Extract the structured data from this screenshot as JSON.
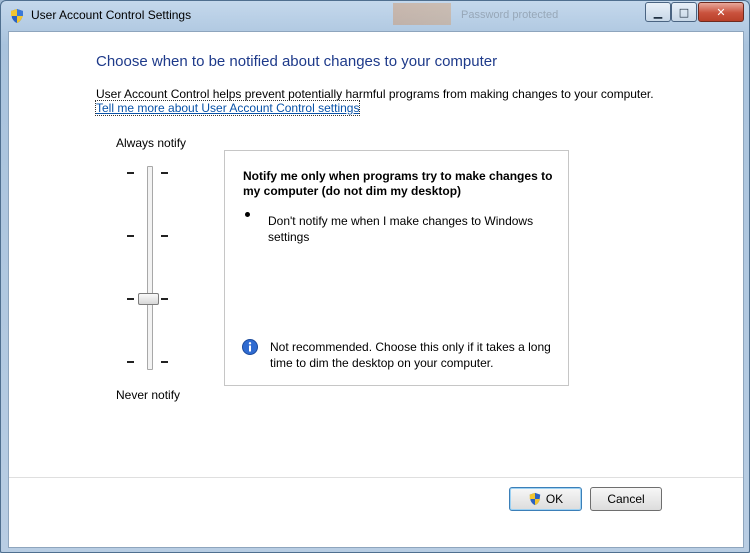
{
  "window": {
    "title": "User Account Control Settings",
    "background_tab_text": "Password protected"
  },
  "content": {
    "heading": "Choose when to be notified about changes to your computer",
    "description": "User Account Control helps prevent potentially harmful programs from making changes to your computer.",
    "link": "Tell me more about User Account Control settings"
  },
  "slider": {
    "top_label": "Always notify",
    "bottom_label": "Never notify",
    "levels": 4,
    "selected_level": 3
  },
  "panel": {
    "title": "Notify me only when programs try to make changes to my computer (do not dim my desktop)",
    "bullets": [
      "Don't notify me when I make changes to Windows settings"
    ],
    "info": "Not recommended. Choose this only if it takes a long time to dim the desktop on your computer."
  },
  "buttons": {
    "ok": "OK",
    "cancel": "Cancel"
  },
  "colors": {
    "heading": "#1e3a8a",
    "link": "#0a53a8"
  },
  "icons": {
    "title": "uac-shield-icon",
    "info": "info-icon",
    "ok_shield": "uac-shield-icon"
  }
}
